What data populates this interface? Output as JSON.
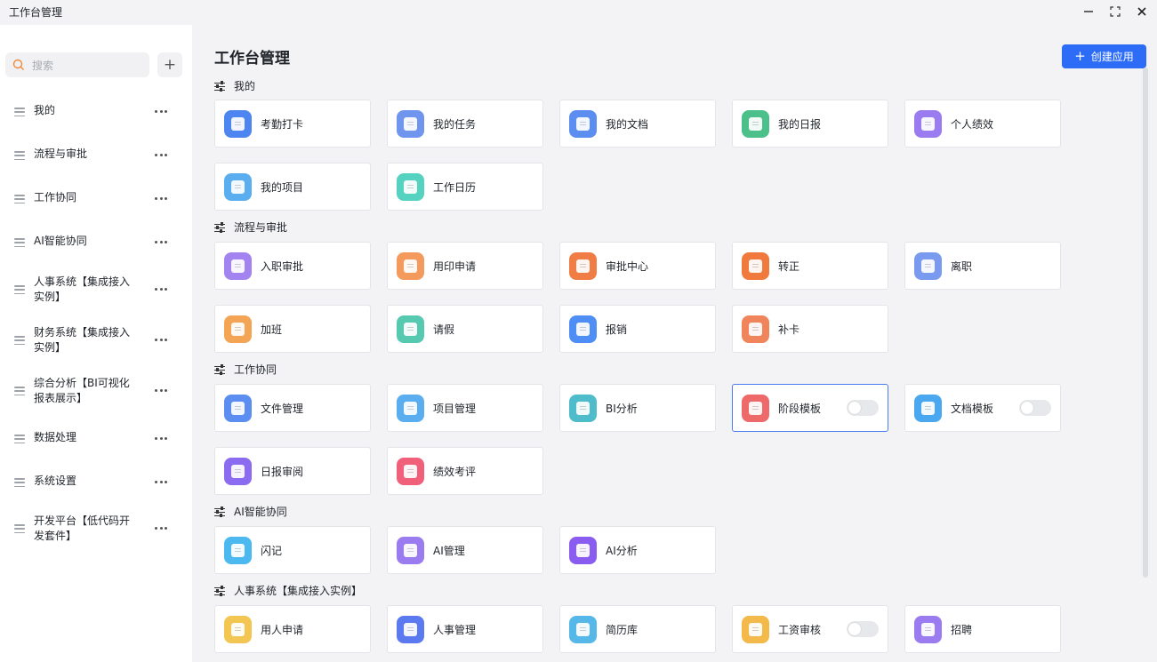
{
  "window": {
    "title": "工作台管理",
    "minimize_icon": "minimize-icon",
    "maximize_icon": "maximize-icon",
    "close_icon": "close-icon"
  },
  "sidebar": {
    "search_placeholder": "搜索",
    "add_icon": "plus-icon",
    "items": [
      {
        "label": "我的"
      },
      {
        "label": "流程与审批"
      },
      {
        "label": "工作协同"
      },
      {
        "label": "AI智能协同"
      },
      {
        "label": "人事系统【集成接入实例】"
      },
      {
        "label": "财务系统【集成接入实例】"
      },
      {
        "label": "综合分析【BI可视化报表展示】"
      },
      {
        "label": "数据处理"
      },
      {
        "label": "系统设置"
      },
      {
        "label": "开发平台【低代码开发套件】"
      }
    ]
  },
  "main": {
    "title": "工作台管理",
    "create_button": "创建应用",
    "sections": [
      {
        "title": "我的",
        "apps": [
          {
            "label": "考勤打卡",
            "icon": "clock-in-icon",
            "color": "#4d86f0"
          },
          {
            "label": "我的任务",
            "icon": "task-icon",
            "color": "#6f95ee"
          },
          {
            "label": "我的文档",
            "icon": "folder-icon",
            "color": "#5b8ef0"
          },
          {
            "label": "我的日报",
            "icon": "daily-report-icon",
            "color": "#4cc08a"
          },
          {
            "label": "个人绩效",
            "icon": "performance-chart-icon",
            "color": "#9b7cf0"
          },
          {
            "label": "我的项目",
            "icon": "project-layers-icon",
            "color": "#5aaef0"
          },
          {
            "label": "工作日历",
            "icon": "calendar-icon",
            "color": "#56d2c0"
          }
        ]
      },
      {
        "title": "流程与审批",
        "apps": [
          {
            "label": "入职审批",
            "icon": "onboarding-icon",
            "color": "#a283f0"
          },
          {
            "label": "用印申请",
            "icon": "seal-icon",
            "color": "#f39a5c"
          },
          {
            "label": "审批中心",
            "icon": "approval-stamp-icon",
            "color": "#f07d45"
          },
          {
            "label": "转正",
            "icon": "regularization-icon",
            "color": "#f07a3e"
          },
          {
            "label": "离职",
            "icon": "resignation-icon",
            "color": "#7a9af0"
          },
          {
            "label": "加班",
            "icon": "overtime-icon",
            "color": "#f3a454"
          },
          {
            "label": "请假",
            "icon": "leave-icon",
            "color": "#56c9b0"
          },
          {
            "label": "报销",
            "icon": "reimbursement-icon",
            "color": "#4f8ef5"
          },
          {
            "label": "补卡",
            "icon": "card-replacement-icon",
            "color": "#f0845a"
          }
        ]
      },
      {
        "title": "工作协同",
        "apps": [
          {
            "label": "文件管理",
            "icon": "file-folder-icon",
            "color": "#5b8ef0",
            "toggle": false
          },
          {
            "label": "项目管理",
            "icon": "project-manage-icon",
            "color": "#5aaef0",
            "toggle": false
          },
          {
            "label": "BI分析",
            "icon": "bi-chart-icon",
            "color": "#4fbccc",
            "toggle": false
          },
          {
            "label": "阶段模板",
            "icon": "stage-template-icon",
            "color": "#ee6a6a",
            "toggle": true,
            "selected": true
          },
          {
            "label": "文档模板",
            "icon": "doc-template-icon",
            "color": "#4aa8f0",
            "toggle": true
          },
          {
            "label": "日报审阅",
            "icon": "report-review-icon",
            "color": "#8b6cf0",
            "toggle": false
          },
          {
            "label": "绩效考评",
            "icon": "performance-review-icon",
            "color": "#f0607a",
            "toggle": false
          }
        ]
      },
      {
        "title": "AI智能协同",
        "apps": [
          {
            "label": "闪记",
            "icon": "flash-note-icon",
            "color": "#4cb8f0"
          },
          {
            "label": "AI管理",
            "icon": "ai-manage-icon",
            "color": "#9a7cf0"
          },
          {
            "label": "AI分析",
            "icon": "ai-robot-icon",
            "color": "#8a5cf0"
          }
        ]
      },
      {
        "title": "人事系统【集成接入实例】",
        "apps": [
          {
            "label": "用人申请",
            "icon": "staffing-request-icon",
            "color": "#f3c552",
            "toggle": false
          },
          {
            "label": "人事管理",
            "icon": "hr-manage-icon",
            "color": "#5b7af0",
            "toggle": false
          },
          {
            "label": "简历库",
            "icon": "resume-icon",
            "color": "#56b8e8",
            "toggle": false
          },
          {
            "label": "工资审核",
            "icon": "salary-review-icon",
            "color": "#f3b94a",
            "toggle": true
          },
          {
            "label": "招聘",
            "icon": "recruit-icon",
            "color": "#9a7cf0",
            "toggle": false
          }
        ]
      }
    ]
  }
}
